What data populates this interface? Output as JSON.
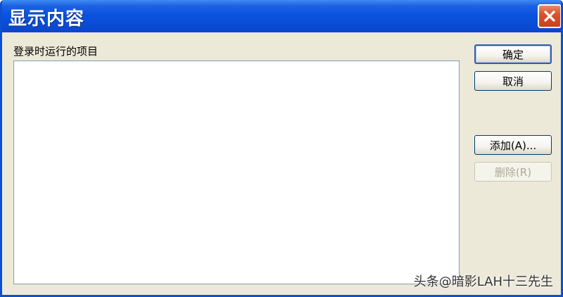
{
  "window": {
    "title": "显示内容",
    "close_icon": "close-icon"
  },
  "main": {
    "list_label": "登录时运行的项目",
    "items": []
  },
  "buttons": {
    "ok": "确定",
    "cancel": "取消",
    "add": "添加(A)...",
    "remove": "删除(R)"
  },
  "watermark": "头条@暗影LAH十三先生",
  "colors": {
    "title_bar": "#0A53DF",
    "dialog_bg": "#ECE9D8",
    "close_button": "#D8542D",
    "listbox_border": "#7F9DB9"
  }
}
